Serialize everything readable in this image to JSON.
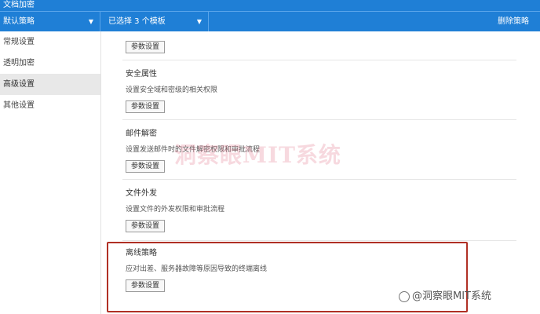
{
  "window": {
    "title": "文档加密"
  },
  "topbar": {
    "policy_label": "默认策略",
    "selected_label": "已选择 3 个模板",
    "delete_label": "删除策略"
  },
  "sidebar": {
    "items": [
      {
        "label": "常规设置"
      },
      {
        "label": "透明加密"
      },
      {
        "label": "高级设置"
      },
      {
        "label": "其他设置"
      }
    ]
  },
  "sections": [
    {
      "title": "",
      "desc": "",
      "button": "参数设置"
    },
    {
      "title": "安全属性",
      "desc": "设置安全域和密级的相关权限",
      "button": "参数设置"
    },
    {
      "title": "邮件解密",
      "desc": "设置发送邮件时的文件解密权限和审批流程",
      "button": "参数设置"
    },
    {
      "title": "文件外发",
      "desc": "设置文件的外发权限和审批流程",
      "button": "参数设置"
    },
    {
      "title": "离线策略",
      "desc": "应对出差、服务器故障等原因导致的终端离线",
      "button": "参数设置"
    }
  ],
  "watermark": {
    "center": "洞察眼MIT系统",
    "corner": "@洞察眼MIT系统"
  },
  "colors": {
    "accent": "#1f7fd6",
    "highlight_border": "#b03025"
  }
}
